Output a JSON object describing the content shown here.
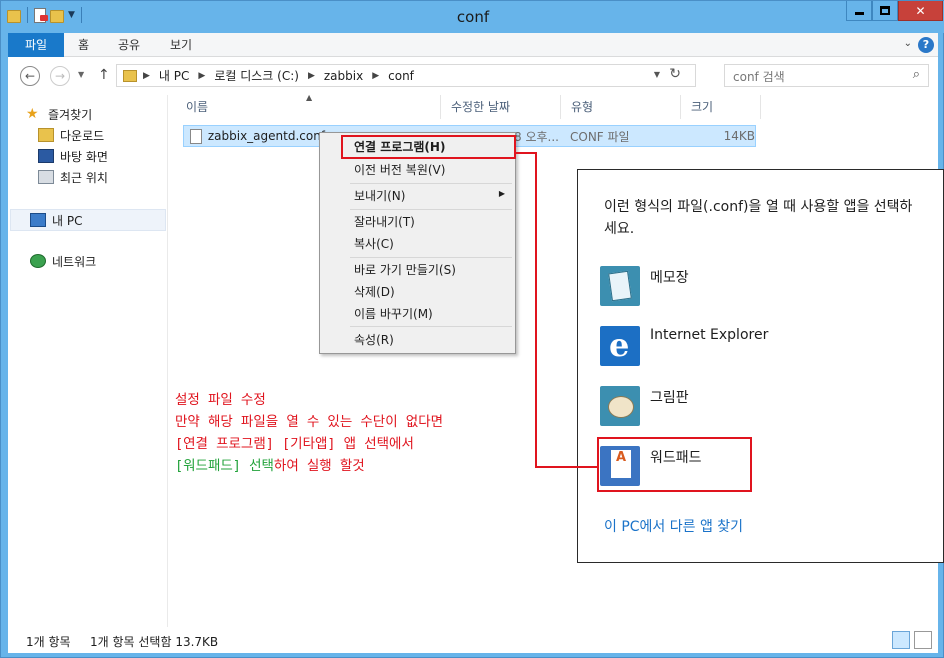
{
  "window": {
    "title": "conf"
  },
  "ribbon": {
    "tabs": [
      "파일",
      "홈",
      "공유",
      "보기"
    ],
    "help_label": "?"
  },
  "address": {
    "crumbs": [
      "내 PC",
      "로컬 디스크 (C:)",
      "zabbix",
      "conf"
    ],
    "search_placeholder": "conf 검색"
  },
  "sidebar": {
    "items": [
      {
        "label": "즐겨찾기",
        "icon": "star-icon"
      },
      {
        "label": "다운로드",
        "icon": "downloads-folder-icon"
      },
      {
        "label": "바탕 화면",
        "icon": "desktop-icon"
      },
      {
        "label": "최근 위치",
        "icon": "recent-places-icon"
      },
      {
        "label": "내 PC",
        "icon": "pc-icon"
      },
      {
        "label": "네트워크",
        "icon": "network-icon"
      }
    ]
  },
  "columns": {
    "name": "이름",
    "date": "수정한 날짜",
    "type": "유형",
    "size": "크기"
  },
  "file": {
    "name": "zabbix_agentd.conf",
    "date": "2020-08-08 오후...",
    "type": "CONF 파일",
    "size": "14KB"
  },
  "context_menu": {
    "items": [
      "연결 프로그램(H)",
      "이전 버전 복원(V)",
      "보내기(N)",
      "잘라내기(T)",
      "복사(C)",
      "바로 가기 만들기(S)",
      "삭제(D)",
      "이름 바꾸기(M)",
      "속성(R)"
    ]
  },
  "annotation": {
    "line1": "설정 파일 수정",
    "line2": "만약 해당 파일을 열 수 있는 수단이 없다면",
    "line3": "[연결 프로그램] [기타앱] 앱 선택에서",
    "line4_green": "[워드패드] 선택",
    "line4_red": "하여 실행 할것",
    "colors": {
      "red": "#e0141e",
      "green": "#21a23a"
    }
  },
  "open_with": {
    "description": "이런 형식의 파일(.conf)을 열 때 사용할 앱을 선택하세요.",
    "apps": [
      {
        "name": "메모장",
        "icon": "notepad-icon"
      },
      {
        "name": "Internet Explorer",
        "icon": "internet-explorer-icon"
      },
      {
        "name": "그림판",
        "icon": "paint-icon"
      },
      {
        "name": "워드패드",
        "icon": "wordpad-icon"
      }
    ],
    "more_link": "이 PC에서 다른 앱 찾기"
  },
  "status": {
    "count": "1개 항목",
    "selected": "1개 항목 선택함 13.7KB"
  }
}
